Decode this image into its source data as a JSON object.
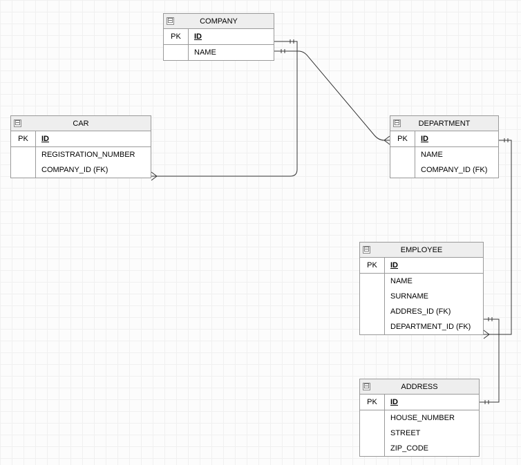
{
  "entities": {
    "company": {
      "title": "COMPANY",
      "pk_label": "PK",
      "pk_field": "ID",
      "attrs": [
        "NAME"
      ]
    },
    "car": {
      "title": "CAR",
      "pk_label": "PK",
      "pk_field": "ID",
      "attrs": [
        "REGISTRATION_NUMBER",
        "COMPANY_ID (FK)"
      ]
    },
    "department": {
      "title": "DEPARTMENT",
      "pk_label": "PK",
      "pk_field": "ID",
      "attrs": [
        "NAME",
        "COMPANY_ID (FK)"
      ]
    },
    "employee": {
      "title": "EMPLOYEE",
      "pk_label": "PK",
      "pk_field": "ID",
      "attrs": [
        "NAME",
        "SURNAME",
        "ADDRES_ID (FK)",
        "DEPARTMENT_ID (FK)"
      ]
    },
    "address": {
      "title": "ADDRESS",
      "pk_label": "PK",
      "pk_field": "ID",
      "attrs": [
        "HOUSE_NUMBER",
        "STREET",
        "ZIP_CODE"
      ]
    }
  },
  "collapse_glyph": "⊟"
}
